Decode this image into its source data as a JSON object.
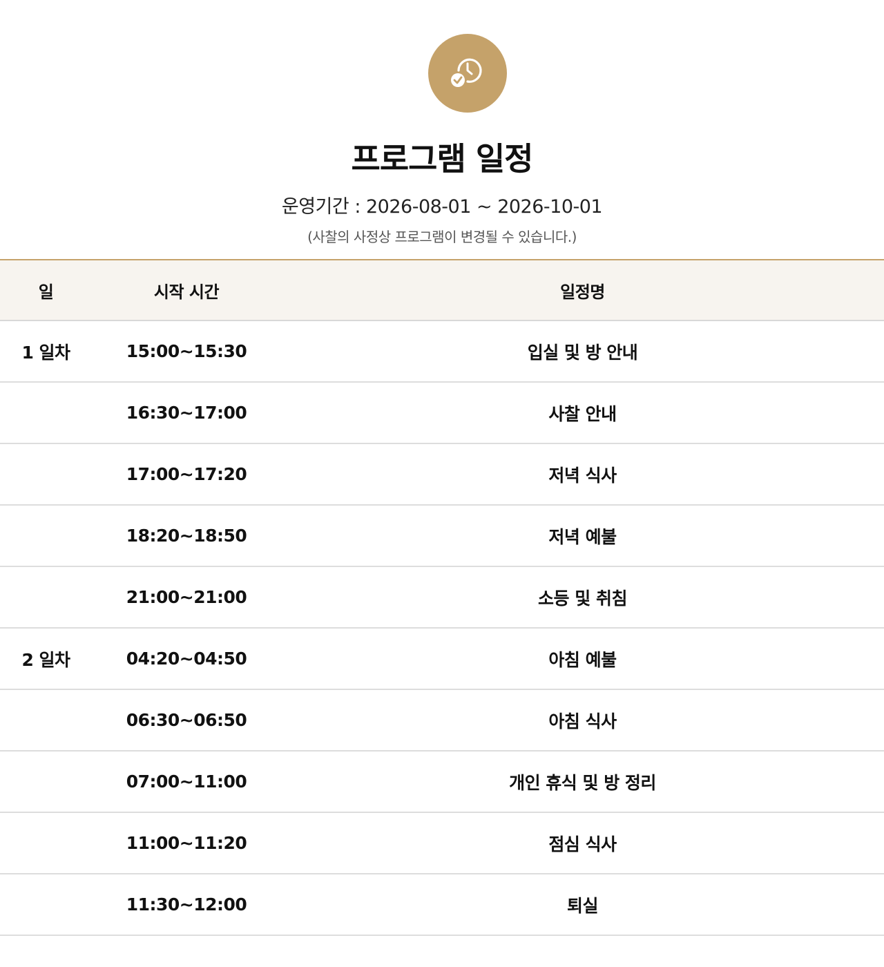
{
  "header": {
    "icon": "clock-check-icon",
    "title": "프로그램 일정",
    "period": "운영기간 : 2026-08-01 ~ 2026-10-01",
    "notice": "(사찰의 사정상 프로그램이 변경될 수 있습니다.)"
  },
  "table": {
    "headers": {
      "day": "일",
      "start_time": "시작 시간",
      "name": "일정명"
    },
    "rows": [
      {
        "day": "1 일차",
        "time": "15:00~15:30",
        "name": "입실 및 방 안내"
      },
      {
        "day": "",
        "time": "16:30~17:00",
        "name": "사찰 안내"
      },
      {
        "day": "",
        "time": "17:00~17:20",
        "name": "저녁 식사"
      },
      {
        "day": "",
        "time": "18:20~18:50",
        "name": "저녁 예불"
      },
      {
        "day": "",
        "time": "21:00~21:00",
        "name": "소등 및 취침"
      },
      {
        "day": "2 일차",
        "time": "04:20~04:50",
        "name": "아침 예불"
      },
      {
        "day": "",
        "time": "06:30~06:50",
        "name": "아침 식사"
      },
      {
        "day": "",
        "time": "07:00~11:00",
        "name": "개인 휴식 및 방 정리"
      },
      {
        "day": "",
        "time": "11:00~11:20",
        "name": "점심 식사"
      },
      {
        "day": "",
        "time": "11:30~12:00",
        "name": "퇴실"
      }
    ]
  },
  "colors": {
    "accent": "#c5a26a",
    "header_bg": "#f7f4ef",
    "divider": "#dddddd"
  }
}
